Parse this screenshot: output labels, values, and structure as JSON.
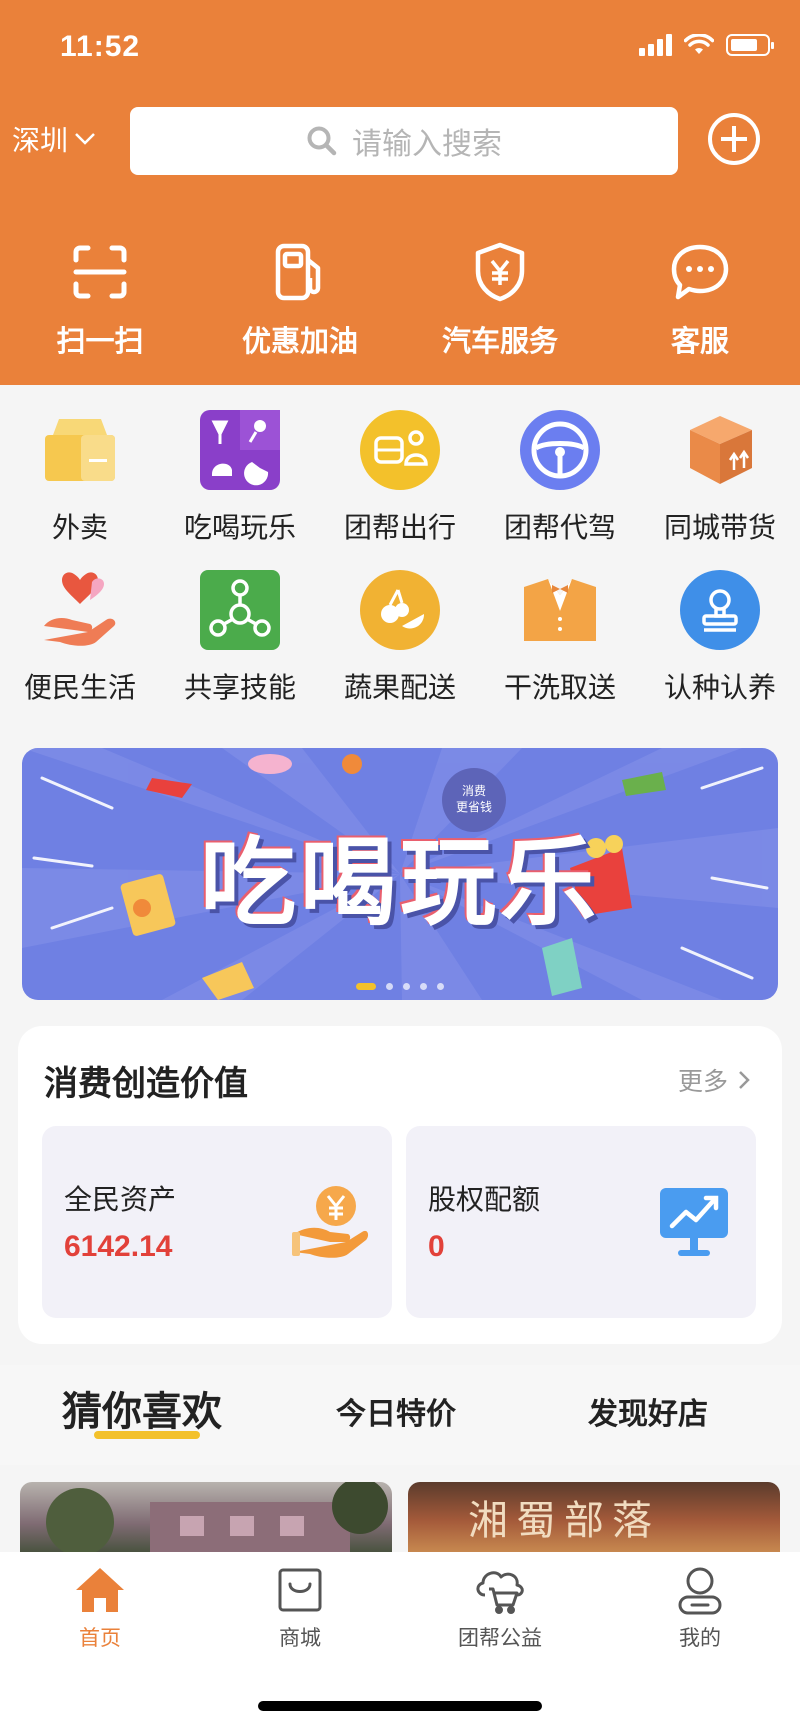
{
  "status_bar": {
    "time": "11:52"
  },
  "header": {
    "city": "深圳",
    "search_placeholder": "请输入搜索",
    "quick_actions": [
      {
        "label": "扫一扫",
        "icon": "scan-icon"
      },
      {
        "label": "优惠加油",
        "icon": "fuel-pump-icon"
      },
      {
        "label": "汽车服务",
        "icon": "shield-yen-icon"
      },
      {
        "label": "客服",
        "icon": "chat-bubble-icon"
      }
    ]
  },
  "services": [
    {
      "label": "外卖",
      "icon": "takeout-box-icon",
      "color": "#f6c84f"
    },
    {
      "label": "吃喝玩乐",
      "icon": "entertainment-icon",
      "color": "#8a3fc9"
    },
    {
      "label": "团帮出行",
      "icon": "travel-icon",
      "color": "#f3c12b"
    },
    {
      "label": "团帮代驾",
      "icon": "steering-wheel-icon",
      "color": "#6b7ef0"
    },
    {
      "label": "同城带货",
      "icon": "parcel-icon",
      "color": "#ea8a48"
    },
    {
      "label": "便民生活",
      "icon": "heart-hand-icon",
      "color": "#e8573f"
    },
    {
      "label": "共享技能",
      "icon": "network-icon",
      "color": "#4bab4b"
    },
    {
      "label": "蔬果配送",
      "icon": "fruit-icon",
      "color": "#f1b233"
    },
    {
      "label": "干洗取送",
      "icon": "suit-icon",
      "color": "#f3a446"
    },
    {
      "label": "认种认养",
      "icon": "stamp-icon",
      "color": "#3f8fe8"
    }
  ],
  "banner": {
    "title": "吃喝玩乐",
    "badge_line1": "消费",
    "badge_line2": "更省钱",
    "slide_count": 5,
    "active_slide": 1
  },
  "value_card": {
    "title": "消费创造价值",
    "more_label": "更多",
    "tiles": [
      {
        "label": "全民资产",
        "value": "6142.14",
        "icon": "coin-hand-icon"
      },
      {
        "label": "股权配额",
        "value": "0",
        "icon": "chart-monitor-icon"
      }
    ]
  },
  "feed_tabs": [
    {
      "label": "猜你喜欢",
      "active": true
    },
    {
      "label": "今日特价",
      "active": false
    },
    {
      "label": "发现好店",
      "active": false
    }
  ],
  "previews": {
    "right_sign": "湘蜀部落"
  },
  "bottom_nav": [
    {
      "label": "首页",
      "icon": "home-icon",
      "active": true
    },
    {
      "label": "商城",
      "icon": "shopping-bag-icon",
      "active": false
    },
    {
      "label": "团帮公益",
      "icon": "cloud-cart-icon",
      "active": false
    },
    {
      "label": "我的",
      "icon": "profile-icon",
      "active": false
    }
  ],
  "colors": {
    "brand_orange": "#ea813a",
    "price_red": "#e2413a",
    "tab_underline": "#f3c12b"
  }
}
